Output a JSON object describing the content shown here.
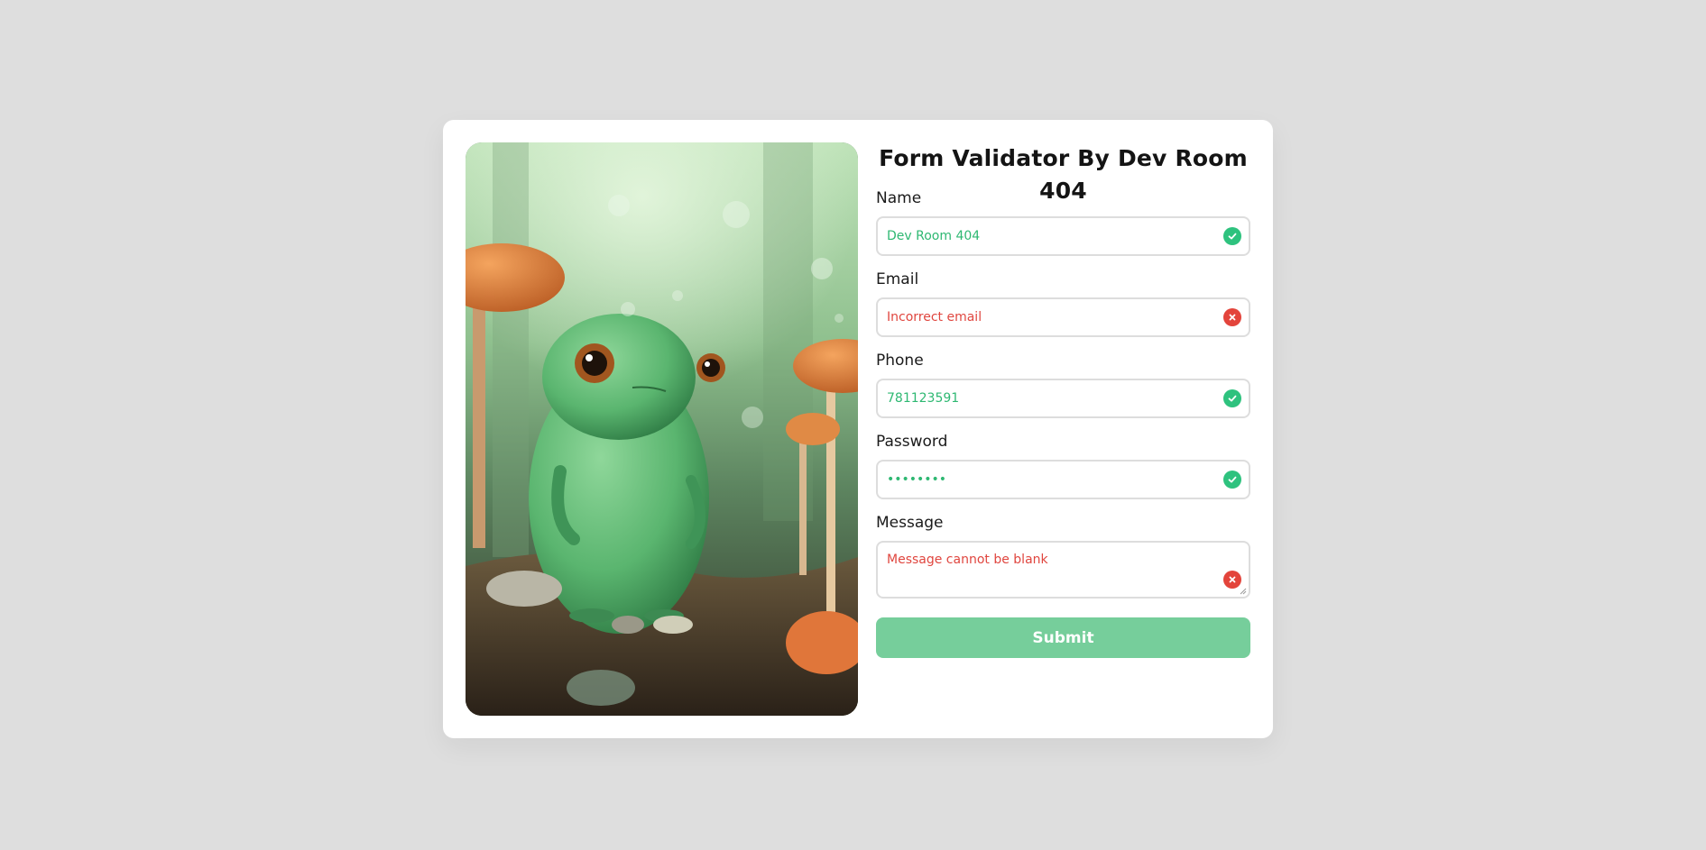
{
  "form": {
    "title": "Form Validator By Dev Room 404",
    "fields": [
      {
        "label": "Name",
        "value": "Dev Room 404",
        "state": "valid",
        "status_icon": "check-icon"
      },
      {
        "label": "Email",
        "value": "",
        "placeholder": "Incorrect email",
        "state": "invalid",
        "status_icon": "cross-icon"
      },
      {
        "label": "Phone",
        "value": "781123591",
        "state": "valid",
        "status_icon": "check-icon"
      },
      {
        "label": "Password",
        "value": "••••••••",
        "state": "valid",
        "status_icon": "check-icon"
      },
      {
        "label": "Message",
        "value": "",
        "placeholder": "Message cannot be blank",
        "state": "invalid",
        "status_icon": "cross-icon"
      }
    ],
    "submit_label": "Submit"
  },
  "image": {
    "subject": "green-frog-character-with-mushrooms"
  },
  "colors": {
    "page_background": "#dedede",
    "card_background": "#ffffff",
    "valid": "#2ec27e",
    "invalid": "#e3443b",
    "submit_background": "#76ce9b",
    "input_border": "#dddddd"
  }
}
